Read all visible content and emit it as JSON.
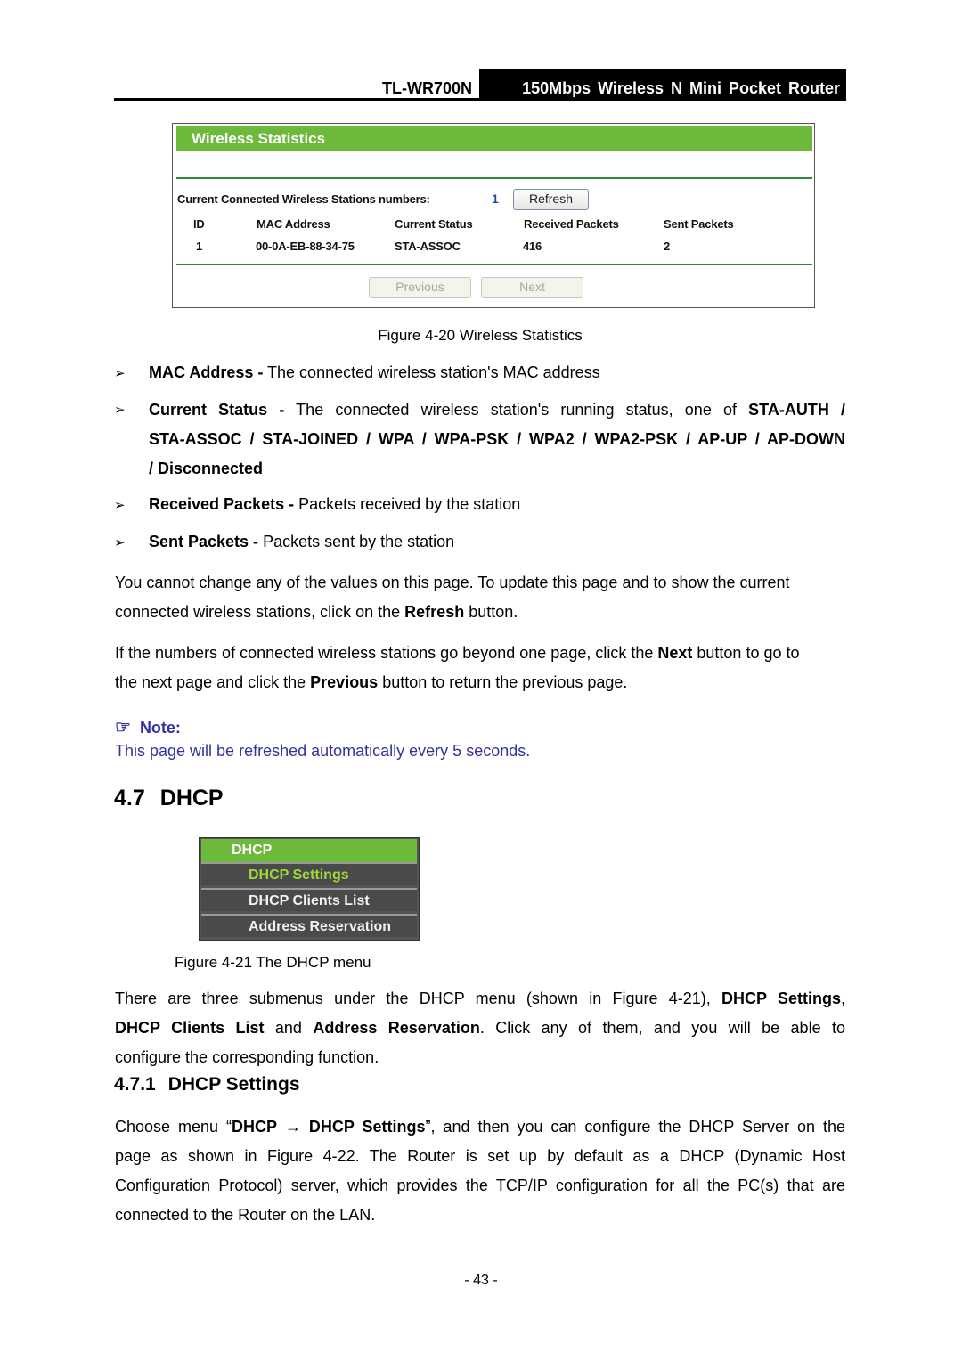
{
  "header": {
    "model": "TL-WR700N",
    "product": "150Mbps Wireless N Mini Pocket Router"
  },
  "wireless_stats_figure": {
    "title": "Wireless Statistics",
    "stations_label": "Current Connected Wireless Stations numbers:",
    "stations_count": "1",
    "refresh_button": "Refresh",
    "columns": [
      "ID",
      "MAC Address",
      "Current Status",
      "Received Packets",
      "Sent Packets"
    ],
    "rows": [
      {
        "id": "1",
        "mac": "00-0A-EB-88-34-75",
        "status": "STA-ASSOC",
        "received": "416",
        "sent": "2"
      }
    ],
    "previous_button": "Previous",
    "next_button": "Next",
    "colors": {
      "title_bar": "#6cb93c",
      "divider": "#2e8b3e",
      "count": "#1b4e9b"
    }
  },
  "figure_4_20_caption": "Figure 4-20 Wireless Statistics",
  "bullets": [
    {
      "term": "MAC Address -",
      "text": " The connected wireless station's MAC address"
    },
    {
      "term": "Current Status -",
      "text": " The connected wireless station's running status, one of ",
      "statuses_line1": "STA-AUTH /",
      "statuses_line2": "STA-ASSOC / STA-JOINED / WPA / WPA-PSK / WPA2 / WPA2-PSK / AP-UP / AP-DOWN",
      "statuses_line3": "/ Disconnected"
    },
    {
      "term": "Received Packets -",
      "text": " Packets received by the station"
    },
    {
      "term": "Sent Packets -",
      "text": " Packets sent by the station"
    }
  ],
  "para1": {
    "line1": "You cannot change any of the values on this page. To update this page and to show the current",
    "line2_pre": "connected wireless stations, click on the ",
    "line2_bold": "Refresh",
    "line2_post": " button."
  },
  "para2": {
    "line1_pre": "If the numbers of connected wireless stations go beyond one page, click the ",
    "line1_bold": "Next",
    "line1_post": " button to go to",
    "line2_pre": "the next page and click the ",
    "line2_bold": "Previous",
    "line2_post": " button to return the previous page."
  },
  "note": {
    "icon": "pointing-hand-icon",
    "label": "Note:",
    "text": "This page will be refreshed automatically every 5 seconds.",
    "color": "#3333a0"
  },
  "section": {
    "number": "4.7",
    "title": "DHCP"
  },
  "dhcp_menu": {
    "head": "DHCP",
    "items": [
      "DHCP Settings",
      "DHCP Clients List",
      "Address Reservation"
    ],
    "active_index": 0,
    "colors": {
      "head_bg": "#6cb93c",
      "active_text": "#9ed93a"
    }
  },
  "figure_4_21_caption": "Figure 4-21 The DHCP menu",
  "para3": {
    "l1_pre": "There are three submenus under the DHCP menu (shown in Figure 4-21), ",
    "l1_bold": "DHCP Settings",
    "l1_post": ",",
    "l2_bold1": "DHCP Clients List",
    "l2_mid": " and ",
    "l2_bold2": "Address Reservation",
    "l2_post": ". Click any of them, and you will be able to",
    "l3": "configure the corresponding function."
  },
  "subsection": {
    "number": "4.7.1",
    "title": "DHCP Settings"
  },
  "para4": {
    "l1_pre": "Choose menu “",
    "l1_bold1": "DHCP",
    "l1_arrow": "→",
    "l1_bold2": "DHCP Settings",
    "l1_post": "”, and then you can configure the DHCP Server on the",
    "l2": "page as shown in Figure 4-22. The Router is set up by default as a DHCP (Dynamic Host",
    "l3": "Configuration Protocol) server, which provides the TCP/IP configuration for all the PC(s) that are",
    "l4": "connected to the Router on the LAN."
  },
  "page_number": "- 43 -"
}
